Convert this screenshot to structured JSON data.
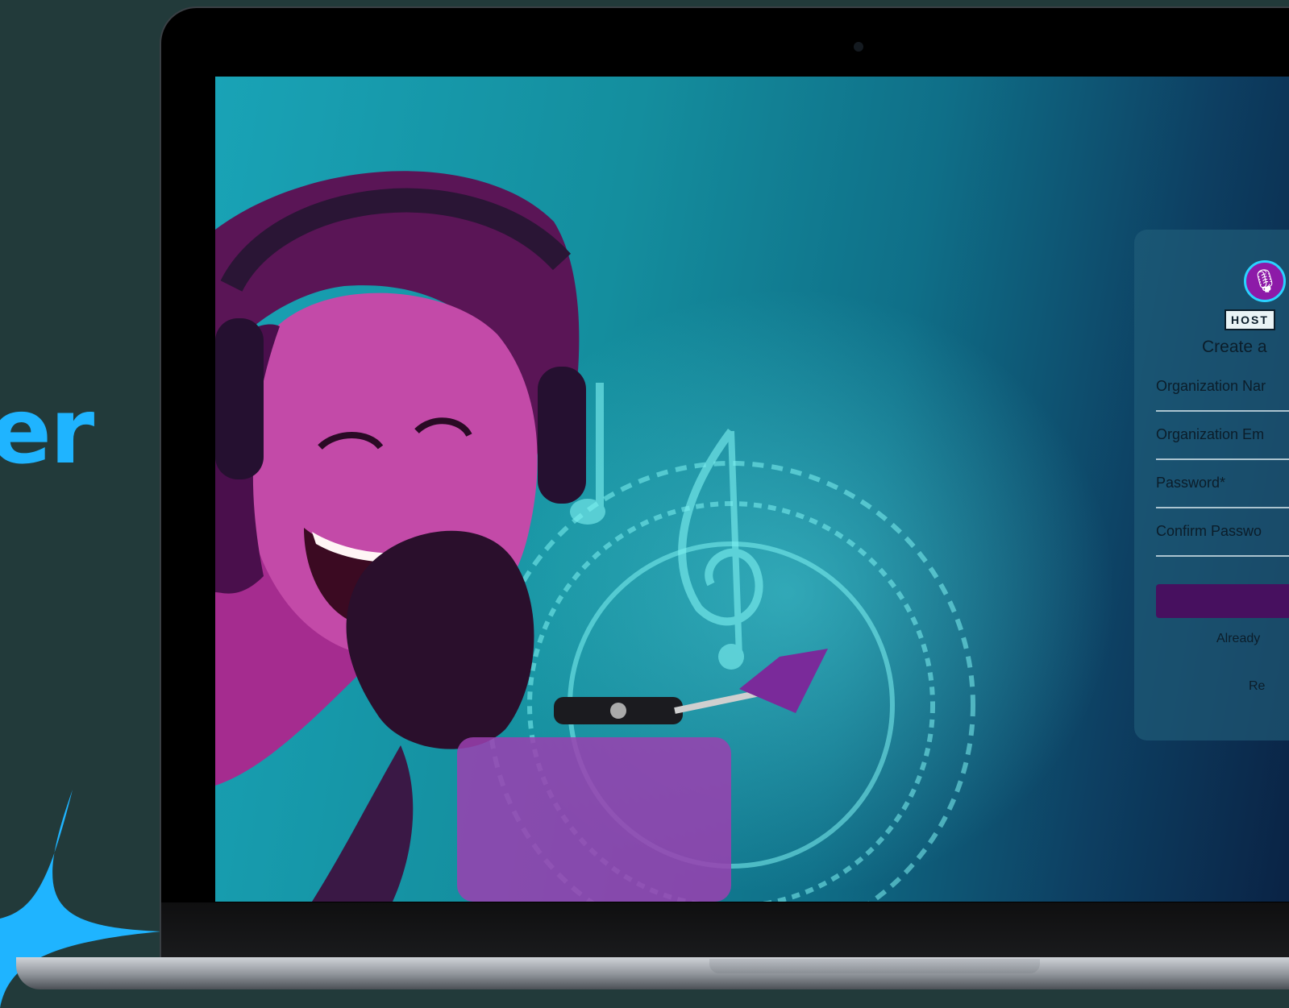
{
  "marketing": {
    "headline_fragment": "er"
  },
  "signup_form": {
    "logo_text": "HOST",
    "title": "Create a",
    "fields": [
      {
        "label": "Organization Nar"
      },
      {
        "label": "Organization Em"
      },
      {
        "label": "Password*"
      },
      {
        "label": "Confirm Passwo"
      }
    ],
    "already_text": "Already",
    "link_fragment": "Re"
  },
  "colors": {
    "page_background": "#223a3a",
    "headline": "#1fb4ff",
    "submit_button": "#47105f",
    "logo_circle": "#8d1aa8"
  },
  "icons": {
    "logo_icon": "microphone-icon"
  }
}
